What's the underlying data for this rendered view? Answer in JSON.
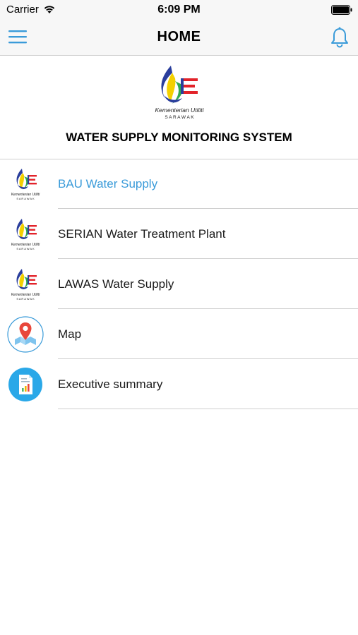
{
  "status_bar": {
    "carrier": "Carrier",
    "time": "6:09 PM"
  },
  "nav": {
    "title": "HOME"
  },
  "header": {
    "logo_line1": "Kementerian Utiliti",
    "logo_line2": "S A R A W A K",
    "title": "WATER SUPPLY MONITORING SYSTEM"
  },
  "menu_items": [
    {
      "label": "BAU Water Supply",
      "icon": "ministry-logo-icon",
      "selected": true
    },
    {
      "label": "SERIAN Water Treatment Plant",
      "icon": "ministry-logo-icon",
      "selected": false
    },
    {
      "label": "LAWAS Water Supply",
      "icon": "ministry-logo-icon",
      "selected": false
    },
    {
      "label": "Map",
      "icon": "map-pin-icon",
      "selected": false
    },
    {
      "label": "Executive summary",
      "icon": "report-icon",
      "selected": false
    }
  ],
  "colors": {
    "accent": "#3a9bd9",
    "navbar": "#f7f7f7",
    "separator": "#cfcfcf"
  }
}
